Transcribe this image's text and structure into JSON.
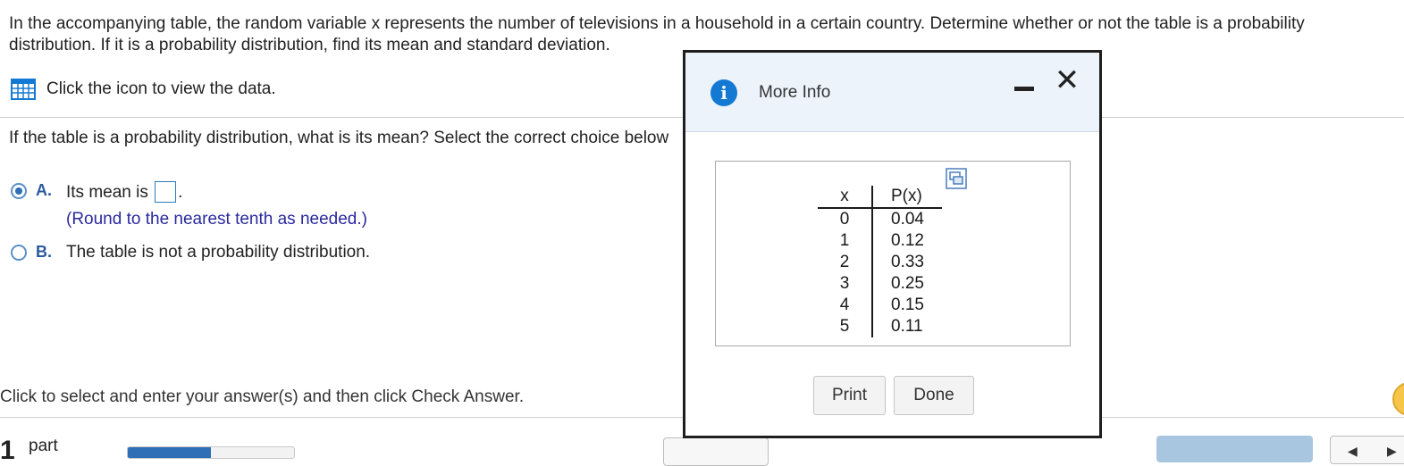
{
  "question": {
    "text": "In the accompanying table, the random variable x represents the number of televisions in a household in a certain country. Determine whether or not the table is a probability distribution. If it is a probability distribution, find its mean and standard deviation."
  },
  "data_link": {
    "label": "Click the icon to view the data."
  },
  "prompt": {
    "text": "If the table is a probability distribution, what is its mean? Select the correct choice below"
  },
  "choices": [
    {
      "letter": "A.",
      "text_before": "Its mean is",
      "text_after": ".",
      "hint": "(Round to the nearest tenth as needed.)",
      "selected": true
    },
    {
      "letter": "B.",
      "text": "The table is not a probability distribution.",
      "selected": false
    }
  ],
  "instruction": {
    "text": "Click to select and enter your answer(s) and then click Check Answer."
  },
  "footer": {
    "part_number": "1",
    "part_word": "part",
    "progress": 0.5
  },
  "dialog": {
    "title": "More Info",
    "table": {
      "headers": [
        "x",
        "P(x)"
      ],
      "rows": [
        [
          "0",
          "0.04"
        ],
        [
          "1",
          "0.12"
        ],
        [
          "2",
          "0.33"
        ],
        [
          "3",
          "0.25"
        ],
        [
          "4",
          "0.15"
        ],
        [
          "5",
          "0.11"
        ]
      ]
    },
    "buttons": {
      "print": "Print",
      "done": "Done"
    }
  },
  "colors": {
    "accent": "#2f6fb5",
    "info": "#1479d2",
    "header_bg": "#edf3fb",
    "hint": "#2a2a9e"
  },
  "icons": [
    "grid-table-icon",
    "info-icon",
    "minimize-icon",
    "close-icon",
    "copy-icon"
  ]
}
